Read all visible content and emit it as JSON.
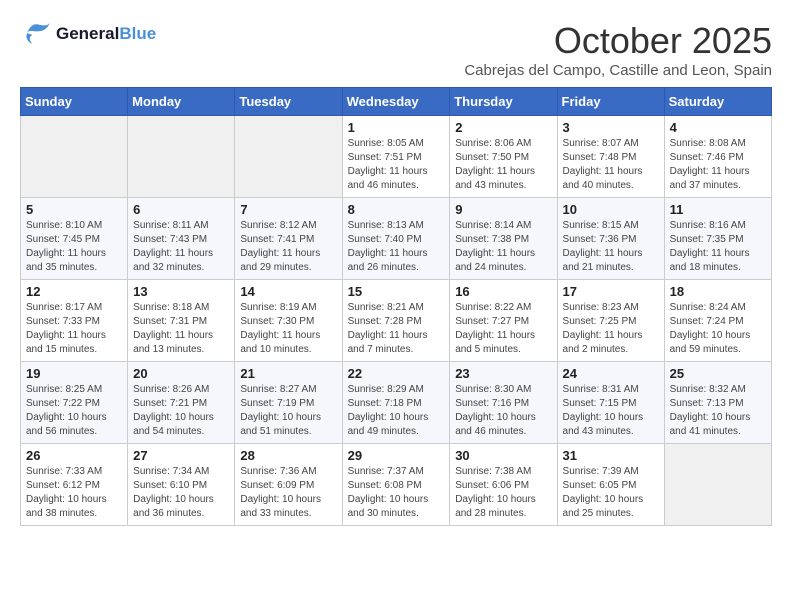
{
  "header": {
    "logo_line1": "General",
    "logo_line2": "Blue",
    "month_year": "October 2025",
    "location": "Cabrejas del Campo, Castille and Leon, Spain"
  },
  "weekdays": [
    "Sunday",
    "Monday",
    "Tuesday",
    "Wednesday",
    "Thursday",
    "Friday",
    "Saturday"
  ],
  "weeks": [
    [
      {
        "day": "",
        "text": ""
      },
      {
        "day": "",
        "text": ""
      },
      {
        "day": "",
        "text": ""
      },
      {
        "day": "1",
        "text": "Sunrise: 8:05 AM\nSunset: 7:51 PM\nDaylight: 11 hours and 46 minutes."
      },
      {
        "day": "2",
        "text": "Sunrise: 8:06 AM\nSunset: 7:50 PM\nDaylight: 11 hours and 43 minutes."
      },
      {
        "day": "3",
        "text": "Sunrise: 8:07 AM\nSunset: 7:48 PM\nDaylight: 11 hours and 40 minutes."
      },
      {
        "day": "4",
        "text": "Sunrise: 8:08 AM\nSunset: 7:46 PM\nDaylight: 11 hours and 37 minutes."
      }
    ],
    [
      {
        "day": "5",
        "text": "Sunrise: 8:10 AM\nSunset: 7:45 PM\nDaylight: 11 hours and 35 minutes."
      },
      {
        "day": "6",
        "text": "Sunrise: 8:11 AM\nSunset: 7:43 PM\nDaylight: 11 hours and 32 minutes."
      },
      {
        "day": "7",
        "text": "Sunrise: 8:12 AM\nSunset: 7:41 PM\nDaylight: 11 hours and 29 minutes."
      },
      {
        "day": "8",
        "text": "Sunrise: 8:13 AM\nSunset: 7:40 PM\nDaylight: 11 hours and 26 minutes."
      },
      {
        "day": "9",
        "text": "Sunrise: 8:14 AM\nSunset: 7:38 PM\nDaylight: 11 hours and 24 minutes."
      },
      {
        "day": "10",
        "text": "Sunrise: 8:15 AM\nSunset: 7:36 PM\nDaylight: 11 hours and 21 minutes."
      },
      {
        "day": "11",
        "text": "Sunrise: 8:16 AM\nSunset: 7:35 PM\nDaylight: 11 hours and 18 minutes."
      }
    ],
    [
      {
        "day": "12",
        "text": "Sunrise: 8:17 AM\nSunset: 7:33 PM\nDaylight: 11 hours and 15 minutes."
      },
      {
        "day": "13",
        "text": "Sunrise: 8:18 AM\nSunset: 7:31 PM\nDaylight: 11 hours and 13 minutes."
      },
      {
        "day": "14",
        "text": "Sunrise: 8:19 AM\nSunset: 7:30 PM\nDaylight: 11 hours and 10 minutes."
      },
      {
        "day": "15",
        "text": "Sunrise: 8:21 AM\nSunset: 7:28 PM\nDaylight: 11 hours and 7 minutes."
      },
      {
        "day": "16",
        "text": "Sunrise: 8:22 AM\nSunset: 7:27 PM\nDaylight: 11 hours and 5 minutes."
      },
      {
        "day": "17",
        "text": "Sunrise: 8:23 AM\nSunset: 7:25 PM\nDaylight: 11 hours and 2 minutes."
      },
      {
        "day": "18",
        "text": "Sunrise: 8:24 AM\nSunset: 7:24 PM\nDaylight: 10 hours and 59 minutes."
      }
    ],
    [
      {
        "day": "19",
        "text": "Sunrise: 8:25 AM\nSunset: 7:22 PM\nDaylight: 10 hours and 56 minutes."
      },
      {
        "day": "20",
        "text": "Sunrise: 8:26 AM\nSunset: 7:21 PM\nDaylight: 10 hours and 54 minutes."
      },
      {
        "day": "21",
        "text": "Sunrise: 8:27 AM\nSunset: 7:19 PM\nDaylight: 10 hours and 51 minutes."
      },
      {
        "day": "22",
        "text": "Sunrise: 8:29 AM\nSunset: 7:18 PM\nDaylight: 10 hours and 49 minutes."
      },
      {
        "day": "23",
        "text": "Sunrise: 8:30 AM\nSunset: 7:16 PM\nDaylight: 10 hours and 46 minutes."
      },
      {
        "day": "24",
        "text": "Sunrise: 8:31 AM\nSunset: 7:15 PM\nDaylight: 10 hours and 43 minutes."
      },
      {
        "day": "25",
        "text": "Sunrise: 8:32 AM\nSunset: 7:13 PM\nDaylight: 10 hours and 41 minutes."
      }
    ],
    [
      {
        "day": "26",
        "text": "Sunrise: 7:33 AM\nSunset: 6:12 PM\nDaylight: 10 hours and 38 minutes."
      },
      {
        "day": "27",
        "text": "Sunrise: 7:34 AM\nSunset: 6:10 PM\nDaylight: 10 hours and 36 minutes."
      },
      {
        "day": "28",
        "text": "Sunrise: 7:36 AM\nSunset: 6:09 PM\nDaylight: 10 hours and 33 minutes."
      },
      {
        "day": "29",
        "text": "Sunrise: 7:37 AM\nSunset: 6:08 PM\nDaylight: 10 hours and 30 minutes."
      },
      {
        "day": "30",
        "text": "Sunrise: 7:38 AM\nSunset: 6:06 PM\nDaylight: 10 hours and 28 minutes."
      },
      {
        "day": "31",
        "text": "Sunrise: 7:39 AM\nSunset: 6:05 PM\nDaylight: 10 hours and 25 minutes."
      },
      {
        "day": "",
        "text": ""
      }
    ]
  ]
}
